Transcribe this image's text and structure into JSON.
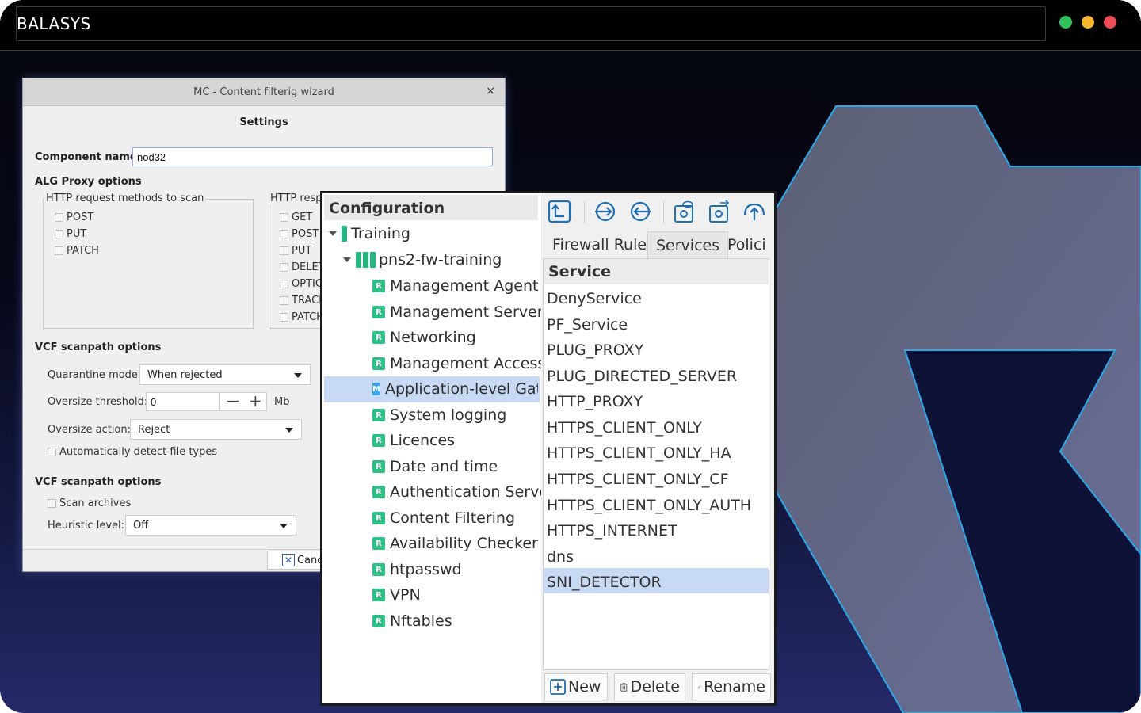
{
  "app": {
    "title": "BALASYS"
  },
  "wizard": {
    "title": "MC - Content filterig wizard",
    "close_glyph": "×",
    "section_title": "Settings",
    "component_name_label": "Component name:",
    "component_name_value": "nod32",
    "alg_proxy_options": "ALG Proxy options",
    "http_request_group": "HTTP request methods to scan",
    "http_request_methods": [
      "POST",
      "PUT",
      "PATCH"
    ],
    "http_response_group": "HTTP resp",
    "http_response_methods": [
      "GET",
      "POST",
      "PUT",
      "DELET",
      "OPTIC",
      "TRACE",
      "PATCH"
    ],
    "vcf_scanpath_1": "VCF scanpath options",
    "quarantine_mode_label": "Quarantine mode:",
    "quarantine_mode_value": "When rejected",
    "oversize_threshold_label": "Oversize threshold:",
    "oversize_threshold_value": "0",
    "oversize_unit": "Mb",
    "minus_glyph": "—",
    "plus_glyph": "+",
    "oversize_action_label": "Oversize action:",
    "oversize_action_value": "Reject",
    "auto_detect_label": "Automatically detect file types",
    "vcf_scanpath_2": "VCF scanpath options",
    "scan_archives_label": "Scan archives",
    "heuristic_level_label": "Heuristic level:",
    "heuristic_level_value": "Off",
    "cancel_label": "Canc"
  },
  "config": {
    "header": "Configuration",
    "tree": {
      "root": "Training",
      "host": "pns2-fw-training",
      "items": [
        {
          "label": "Management Agent",
          "badge": "R"
        },
        {
          "label": "Management Server",
          "badge": "R"
        },
        {
          "label": "Networking",
          "badge": "R"
        },
        {
          "label": "Management Access",
          "badge": "R"
        },
        {
          "label": "Application-level Gatev",
          "badge": "M"
        },
        {
          "label": "System logging",
          "badge": "R"
        },
        {
          "label": "Licences",
          "badge": "R"
        },
        {
          "label": "Date and time",
          "badge": "R"
        },
        {
          "label": "Authentication Server",
          "badge": "R"
        },
        {
          "label": "Content Filtering",
          "badge": "R"
        },
        {
          "label": "Availability Checker",
          "badge": "R"
        },
        {
          "label": "htpasswd",
          "badge": "R"
        },
        {
          "label": "VPN",
          "badge": "R"
        },
        {
          "label": "Nftables",
          "badge": "R"
        }
      ],
      "selected_index": 4
    },
    "toolbar_icons": [
      "upload-config-icon",
      "arrow-right-circle-icon",
      "arrow-left-circle-icon",
      "gear-view-icon",
      "gear-transfer-icon",
      "cloud-upload-icon"
    ],
    "tabs": [
      "Firewall Rules",
      "Services",
      "Polici"
    ],
    "active_tab": "Services",
    "services_header": "Service",
    "services": [
      "DenyService",
      "PF_Service",
      "PLUG_PROXY",
      "PLUG_DIRECTED_SERVER",
      "HTTP_PROXY",
      "HTTPS_CLIENT_ONLY",
      "HTTPS_CLIENT_ONLY_HA",
      "HTTPS_CLIENT_ONLY_CF",
      "HTTPS_CLIENT_ONLY_AUTH",
      "HTTPS_INTERNET",
      "dns",
      "SNI_DETECTOR"
    ],
    "selected_service": "SNI_DETECTOR",
    "buttons": {
      "new": "New",
      "delete": "Delete",
      "rename": "Rename"
    }
  },
  "colors": {
    "accent_blue": "#3aa6e8",
    "selection": "#c8d9f3",
    "r_badge": "#2fbf86",
    "traffic_green": "#2fc25b",
    "traffic_yellow": "#f7b731",
    "traffic_red": "#ec4c57"
  }
}
